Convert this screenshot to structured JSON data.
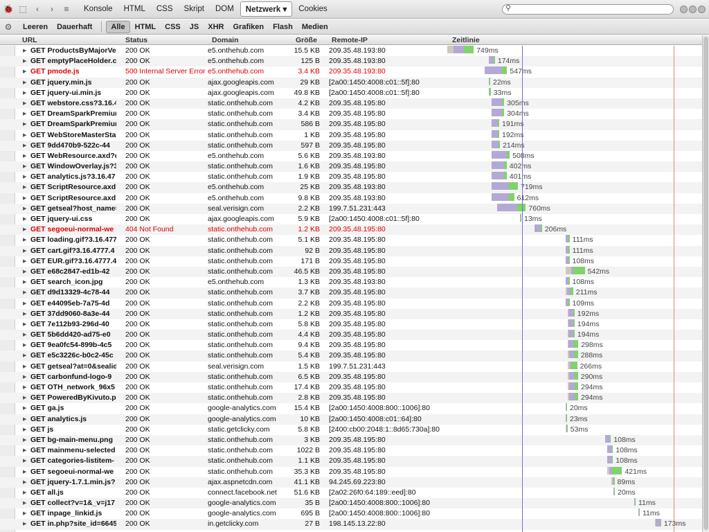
{
  "toolbar": {
    "tabs": [
      "Konsole",
      "HTML",
      "CSS",
      "Skript",
      "DOM",
      "Netzwerk ▾",
      "Cookies"
    ],
    "selected_tab": 5
  },
  "filters": {
    "buttons": [
      "Leeren",
      "Dauerhaft",
      "Alle",
      "HTML",
      "CSS",
      "JS",
      "XHR",
      "Grafiken",
      "Flash",
      "Medien"
    ],
    "selected": 2
  },
  "columns": {
    "url": "URL",
    "status": "Status",
    "domain": "Domain",
    "size": "Größe",
    "remote_ip": "Remote-IP",
    "timeline": "Zeitlinie"
  },
  "requests": [
    {
      "url": "ProductsByMajorVer",
      "status": "200 OK",
      "domain": "e5.onthehub.com",
      "size": "15.5 KB",
      "ip": "209.35.48.193:80",
      "time": "749ms",
      "start": 0,
      "wait": 0.04,
      "recv": 0.04,
      "err": false
    },
    {
      "url": "emptyPlaceHolder.c",
      "status": "200 OK",
      "domain": "e5.onthehub.com",
      "size": "125 B",
      "ip": "209.35.48.193:80",
      "time": "174ms",
      "start": 0.1,
      "wait": 0.02,
      "recv": 0.004,
      "err": false
    },
    {
      "url": "pmode.js",
      "status": "500 Internal Server Error",
      "domain": "e5.onthehub.com",
      "size": "3.4 KB",
      "ip": "209.35.48.193:80",
      "time": "547ms",
      "start": 0.09,
      "wait": 0.07,
      "recv": 0.02,
      "err": true
    },
    {
      "url": "jquery.min.js",
      "status": "200 OK",
      "domain": "ajax.googleapis.com",
      "size": "29 KB",
      "ip": "[2a00:1450:4008:c01::5f]:80",
      "time": "22ms",
      "start": 0.1,
      "wait": 0.002,
      "recv": 0.002,
      "err": false
    },
    {
      "url": "jquery-ui.min.js",
      "status": "200 OK",
      "domain": "ajax.googleapis.com",
      "size": "49.8 KB",
      "ip": "[2a00:1450:4008:c01::5f]:80",
      "time": "33ms",
      "start": 0.1,
      "wait": 0.002,
      "recv": 0.005,
      "err": false
    },
    {
      "url": "webstore.css?3.16.4",
      "status": "200 OK",
      "domain": "static.onthehub.com",
      "size": "4.2 KB",
      "ip": "209.35.48.195:80",
      "time": "305ms",
      "start": 0.107,
      "wait": 0.04,
      "recv": 0.01,
      "err": false
    },
    {
      "url": "DreamSparkPremiur",
      "status": "200 OK",
      "domain": "static.onthehub.com",
      "size": "3.4 KB",
      "ip": "209.35.48.195:80",
      "time": "304ms",
      "start": 0.107,
      "wait": 0.04,
      "recv": 0.01,
      "err": false
    },
    {
      "url": "DreamSparkPremiur",
      "status": "200 OK",
      "domain": "static.onthehub.com",
      "size": "586 B",
      "ip": "209.35.48.195:80",
      "time": "191ms",
      "start": 0.107,
      "wait": 0.025,
      "recv": 0.005,
      "err": false
    },
    {
      "url": "WebStoreMasterStar",
      "status": "200 OK",
      "domain": "static.onthehub.com",
      "size": "1 KB",
      "ip": "209.35.48.195:80",
      "time": "192ms",
      "start": 0.107,
      "wait": 0.025,
      "recv": 0.005,
      "err": false
    },
    {
      "url": "9dd470b9-522c-44",
      "status": "200 OK",
      "domain": "static.onthehub.com",
      "size": "597 B",
      "ip": "209.35.48.195:80",
      "time": "214ms",
      "start": 0.107,
      "wait": 0.028,
      "recv": 0.005,
      "err": false
    },
    {
      "url": "WebResource.axd?d",
      "status": "200 OK",
      "domain": "e5.onthehub.com",
      "size": "5.6 KB",
      "ip": "209.35.48.193:80",
      "time": "508ms",
      "start": 0.107,
      "wait": 0.06,
      "recv": 0.012,
      "err": false
    },
    {
      "url": "WindowOverlay.js?3",
      "status": "200 OK",
      "domain": "static.onthehub.com",
      "size": "1.6 KB",
      "ip": "209.35.48.195:80",
      "time": "402ms",
      "start": 0.107,
      "wait": 0.05,
      "recv": 0.01,
      "err": false
    },
    {
      "url": "analytics.js?3.16.47",
      "status": "200 OK",
      "domain": "static.onthehub.com",
      "size": "1.9 KB",
      "ip": "209.35.48.195:80",
      "time": "401ms",
      "start": 0.107,
      "wait": 0.05,
      "recv": 0.01,
      "err": false
    },
    {
      "url": "ScriptResource.axd?",
      "status": "200 OK",
      "domain": "e5.onthehub.com",
      "size": "25 KB",
      "ip": "209.35.48.193:80",
      "time": "719ms",
      "start": 0.107,
      "wait": 0.07,
      "recv": 0.035,
      "err": false
    },
    {
      "url": "ScriptResource.axd?",
      "status": "200 OK",
      "domain": "e5.onthehub.com",
      "size": "9.8 KB",
      "ip": "209.35.48.193:80",
      "time": "612ms",
      "start": 0.107,
      "wait": 0.07,
      "recv": 0.02,
      "err": false
    },
    {
      "url": "getseal?host_name=",
      "status": "200 OK",
      "domain": "seal.verisign.com",
      "size": "2.2 KB",
      "ip": "199.7.51.231:443",
      "time": "760ms",
      "start": 0.12,
      "wait": 0.08,
      "recv": 0.035,
      "err": false
    },
    {
      "url": "jquery-ui.css",
      "status": "200 OK",
      "domain": "ajax.googleapis.com",
      "size": "5.9 KB",
      "ip": "[2a00:1450:4008:c01::5f]:80",
      "time": "13ms",
      "start": 0.175,
      "wait": 0.001,
      "recv": 0.001,
      "err": false
    },
    {
      "url": "segoeui-normal-we",
      "status": "404 Not Found",
      "domain": "static.onthehub.com",
      "size": "1.2 KB",
      "ip": "209.35.48.195:80",
      "time": "206ms",
      "start": 0.21,
      "wait": 0.025,
      "recv": 0.005,
      "err": true
    },
    {
      "url": "loading.gif?3.16.477",
      "status": "200 OK",
      "domain": "static.onthehub.com",
      "size": "5.1 KB",
      "ip": "209.35.48.195:80",
      "time": "111ms",
      "start": 0.285,
      "wait": 0.01,
      "recv": 0.005,
      "err": false
    },
    {
      "url": "cart.gif?3.16.4777.4",
      "status": "200 OK",
      "domain": "static.onthehub.com",
      "size": "92 B",
      "ip": "209.35.48.195:80",
      "time": "111ms",
      "start": 0.285,
      "wait": 0.01,
      "recv": 0.005,
      "err": false
    },
    {
      "url": "EUR.gif?3.16.4777.4",
      "status": "200 OK",
      "domain": "static.onthehub.com",
      "size": "171 B",
      "ip": "209.35.48.195:80",
      "time": "108ms",
      "start": 0.285,
      "wait": 0.01,
      "recv": 0.005,
      "err": false
    },
    {
      "url": "e68c2847-ed1b-42",
      "status": "200 OK",
      "domain": "static.onthehub.com",
      "size": "46.5 KB",
      "ip": "209.35.48.195:80",
      "time": "542ms",
      "start": 0.285,
      "wait": 0.01,
      "recv": 0.045,
      "err": false
    },
    {
      "url": "search_icon.jpg",
      "status": "200 OK",
      "domain": "e5.onthehub.com",
      "size": "1.3 KB",
      "ip": "209.35.48.193:80",
      "time": "108ms",
      "start": 0.285,
      "wait": 0.01,
      "recv": 0.005,
      "err": false
    },
    {
      "url": "d9d13329-4c78-44",
      "status": "200 OK",
      "domain": "static.onthehub.com",
      "size": "3.7 KB",
      "ip": "209.35.48.195:80",
      "time": "211ms",
      "start": 0.285,
      "wait": 0.015,
      "recv": 0.01,
      "err": false
    },
    {
      "url": "e44095eb-7a75-4d",
      "status": "200 OK",
      "domain": "static.onthehub.com",
      "size": "2.2 KB",
      "ip": "209.35.48.195:80",
      "time": "109ms",
      "start": 0.285,
      "wait": 0.01,
      "recv": 0.005,
      "err": false
    },
    {
      "url": "37dd9060-8a3e-44",
      "status": "200 OK",
      "domain": "static.onthehub.com",
      "size": "1.2 KB",
      "ip": "209.35.48.195:80",
      "time": "192ms",
      "start": 0.29,
      "wait": 0.02,
      "recv": 0.005,
      "err": false
    },
    {
      "url": "7e112b93-296d-40",
      "status": "200 OK",
      "domain": "static.onthehub.com",
      "size": "5.8 KB",
      "ip": "209.35.48.195:80",
      "time": "194ms",
      "start": 0.29,
      "wait": 0.02,
      "recv": 0.006,
      "err": false
    },
    {
      "url": "5b6dd420-ad75-e0",
      "status": "200 OK",
      "domain": "static.onthehub.com",
      "size": "4.4 KB",
      "ip": "209.35.48.195:80",
      "time": "194ms",
      "start": 0.29,
      "wait": 0.02,
      "recv": 0.006,
      "err": false
    },
    {
      "url": "9ea0fc54-899b-4c5",
      "status": "200 OK",
      "domain": "static.onthehub.com",
      "size": "9.4 KB",
      "ip": "209.35.48.195:80",
      "time": "298ms",
      "start": 0.29,
      "wait": 0.02,
      "recv": 0.02,
      "err": false
    },
    {
      "url": "e5c3226c-b0c2-45c",
      "status": "200 OK",
      "domain": "static.onthehub.com",
      "size": "5.4 KB",
      "ip": "209.35.48.195:80",
      "time": "288ms",
      "start": 0.29,
      "wait": 0.02,
      "recv": 0.015,
      "err": false
    },
    {
      "url": "getseal?at=0&sealid",
      "status": "200 OK",
      "domain": "seal.verisign.com",
      "size": "1.5 KB",
      "ip": "199.7.51.231:443",
      "time": "266ms",
      "start": 0.29,
      "wait": 0.005,
      "recv": 0.025,
      "err": false
    },
    {
      "url": "carbonfund-logo-9",
      "status": "200 OK",
      "domain": "static.onthehub.com",
      "size": "6.5 KB",
      "ip": "209.35.48.195:80",
      "time": "290ms",
      "start": 0.29,
      "wait": 0.02,
      "recv": 0.015,
      "err": false
    },
    {
      "url": "OTH_network_96x5",
      "status": "200 OK",
      "domain": "static.onthehub.com",
      "size": "17.4 KB",
      "ip": "209.35.48.195:80",
      "time": "294ms",
      "start": 0.29,
      "wait": 0.02,
      "recv": 0.015,
      "err": false
    },
    {
      "url": "PoweredByKivuto.pr",
      "status": "200 OK",
      "domain": "static.onthehub.com",
      "size": "2.8 KB",
      "ip": "209.35.48.195:80",
      "time": "294ms",
      "start": 0.29,
      "wait": 0.02,
      "recv": 0.015,
      "err": false
    },
    {
      "url": "ga.js",
      "status": "200 OK",
      "domain": "google-analytics.com",
      "size": "15.4 KB",
      "ip": "[2a00:1450:4008:800::1006]:80",
      "time": "20ms",
      "start": 0.285,
      "wait": 0.001,
      "recv": 0.001,
      "err": false
    },
    {
      "url": "analytics.js",
      "status": "200 OK",
      "domain": "google-analytics.com",
      "size": "10 KB",
      "ip": "[2a00:1450:4008:c01::64]:80",
      "time": "23ms",
      "start": 0.285,
      "wait": 0.001,
      "recv": 0.001,
      "err": false
    },
    {
      "url": "js",
      "status": "200 OK",
      "domain": "static.getclicky.com",
      "size": "5.8 KB",
      "ip": "[2400:cb00:2048:1::8d65:730a]:80",
      "time": "53ms",
      "start": 0.285,
      "wait": 0.002,
      "recv": 0.002,
      "err": false
    },
    {
      "url": "bg-main-menu.png",
      "status": "200 OK",
      "domain": "static.onthehub.com",
      "size": "3 KB",
      "ip": "209.35.48.195:80",
      "time": "108ms",
      "start": 0.38,
      "wait": 0.02,
      "recv": 0.003,
      "err": false
    },
    {
      "url": "mainmenu-selected",
      "status": "200 OK",
      "domain": "static.onthehub.com",
      "size": "1022 B",
      "ip": "209.35.48.195:80",
      "time": "108ms",
      "start": 0.385,
      "wait": 0.02,
      "recv": 0.003,
      "err": false
    },
    {
      "url": "categories-listitem-",
      "status": "200 OK",
      "domain": "static.onthehub.com",
      "size": "1.1 KB",
      "ip": "209.35.48.195:80",
      "time": "108ms",
      "start": 0.385,
      "wait": 0.02,
      "recv": 0.003,
      "err": false
    },
    {
      "url": "segoeui-normal-we",
      "status": "200 OK",
      "domain": "static.onthehub.com",
      "size": "35.3 KB",
      "ip": "209.35.48.195:80",
      "time": "421ms",
      "start": 0.385,
      "wait": 0.01,
      "recv": 0.04,
      "err": false
    },
    {
      "url": "jquery-1.7.1.min.js?",
      "status": "200 OK",
      "domain": "ajax.aspnetcdn.com",
      "size": "41.1 KB",
      "ip": "94.245.69.223:80",
      "time": "89ms",
      "start": 0.395,
      "wait": 0.003,
      "recv": 0.003,
      "err": false
    },
    {
      "url": "all.js",
      "status": "200 OK",
      "domain": "connect.facebook.net",
      "size": "51.6 KB",
      "ip": "[2a02:26f0:64:189::eed]:80",
      "time": "20ms",
      "start": 0.4,
      "wait": 0.001,
      "recv": 0.001,
      "err": false
    },
    {
      "url": "collect?v=1&_v=j17",
      "status": "200 OK",
      "domain": "google-analytics.com",
      "size": "35 B",
      "ip": "[2a00:1450:4008:800::1006]:80",
      "time": "11ms",
      "start": 0.45,
      "wait": 0.001,
      "recv": 0.001,
      "err": false
    },
    {
      "url": "inpage_linkid.js",
      "status": "200 OK",
      "domain": "google-analytics.com",
      "size": "695 B",
      "ip": "[2a00:1450:4008:800::1006]:80",
      "time": "11ms",
      "start": 0.46,
      "wait": 0.001,
      "recv": 0.001,
      "err": false
    },
    {
      "url": "in.php?site_id=6645",
      "status": "200 OK",
      "domain": "in.getclicky.com",
      "size": "27 B",
      "ip": "198.145.13.22:80",
      "time": "173ms",
      "start": 0.5,
      "wait": 0.02,
      "recv": 0.002,
      "err": false
    }
  ],
  "colors": {
    "blocking": "#cfc8bc",
    "waiting": "#b3a8d6",
    "receiving": "#7fd36b",
    "error": "#dd0000",
    "domcontent": "#6d6dd8",
    "load": "#e08a6a"
  }
}
